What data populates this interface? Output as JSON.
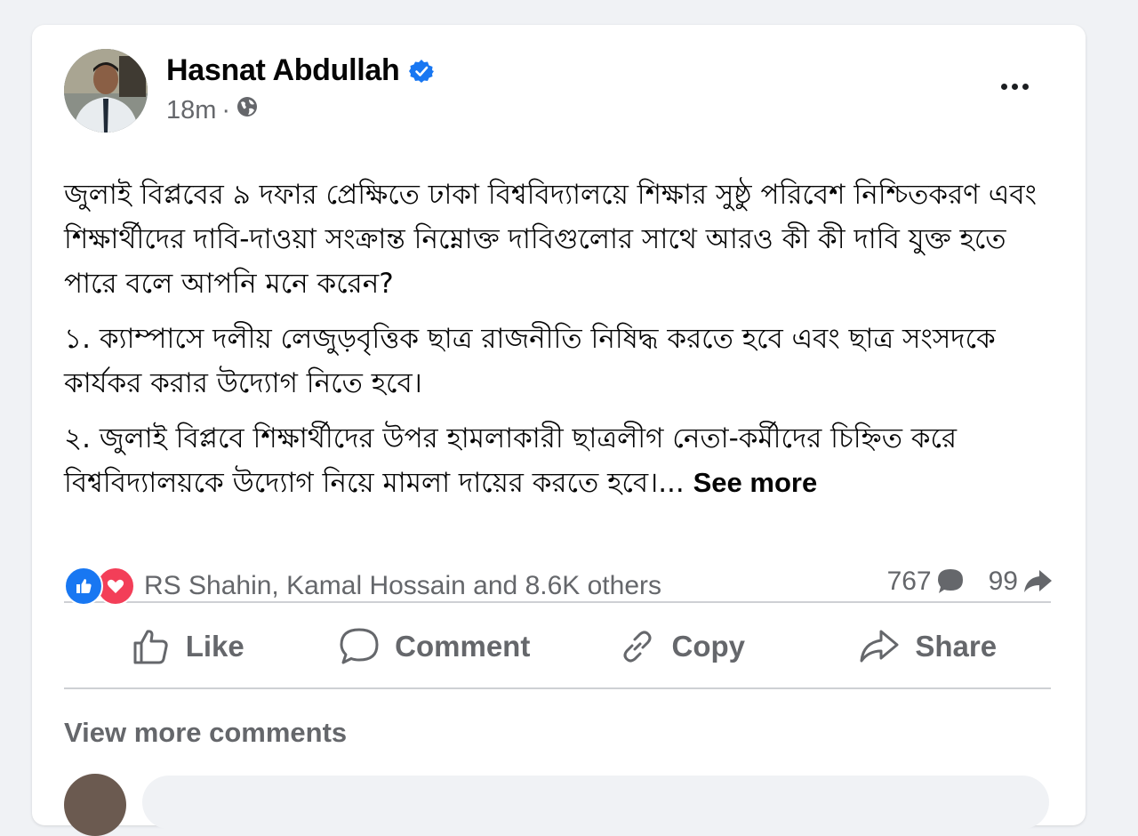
{
  "post": {
    "author": "Hasnat Abdullah",
    "time": "18m",
    "separator": "·",
    "paragraphs": [
      "জুলাই বিপ্লবের ৯ দফার প্রেক্ষিতে ঢাকা বিশ্ববিদ্যালয়ে শিক্ষার সুষ্ঠু পরিবেশ নিশ্চিতকরণ এবং শিক্ষার্থীদের দাবি-দাওয়া সংক্রান্ত নিম্নোক্ত দাবিগুলোর সাথে আরও কী কী দাবি যুক্ত হতে পারে বলে আপনি মনে করেন?",
      "১. ক্যাম্পাসে দলীয় লেজুড়বৃত্তিক ছাত্র রাজনীতি নিষিদ্ধ করতে হবে এবং ছাত্র সংসদকে কার্যকর করার উদ্যোগ নিতে হবে।",
      "২. জুলাই বিপ্লবে শিক্ষার্থীদের উপর হামলাকারী ছাত্রলীগ নেতা-কর্মীদের চিহ্নিত করে বিশ্ববিদ্যালয়কে উদ্যোগ নিয়ে মামলা দায়ের করতে হবে।..."
    ],
    "see_more": "See more"
  },
  "stats": {
    "reactors": "RS Shahin, Kamal Hossain and 8.6K others",
    "comments": "767",
    "shares": "99"
  },
  "actions": {
    "like": "Like",
    "comment": "Comment",
    "copy": "Copy",
    "share": "Share"
  },
  "comments": {
    "view_more": "View more comments"
  },
  "colors": {
    "like_blue": "#1877f2",
    "love_red": "#f33e58",
    "verified_blue": "#1877f2",
    "secondary_text": "#65676b"
  },
  "icons": {
    "verified": "verified-badge-icon",
    "audience": "globe-icon",
    "more": "more-options-icon",
    "like_reaction": "like-reaction-icon",
    "love_reaction": "love-reaction-icon",
    "comment_count": "comment-bubble-icon",
    "share_count": "share-arrow-icon"
  }
}
